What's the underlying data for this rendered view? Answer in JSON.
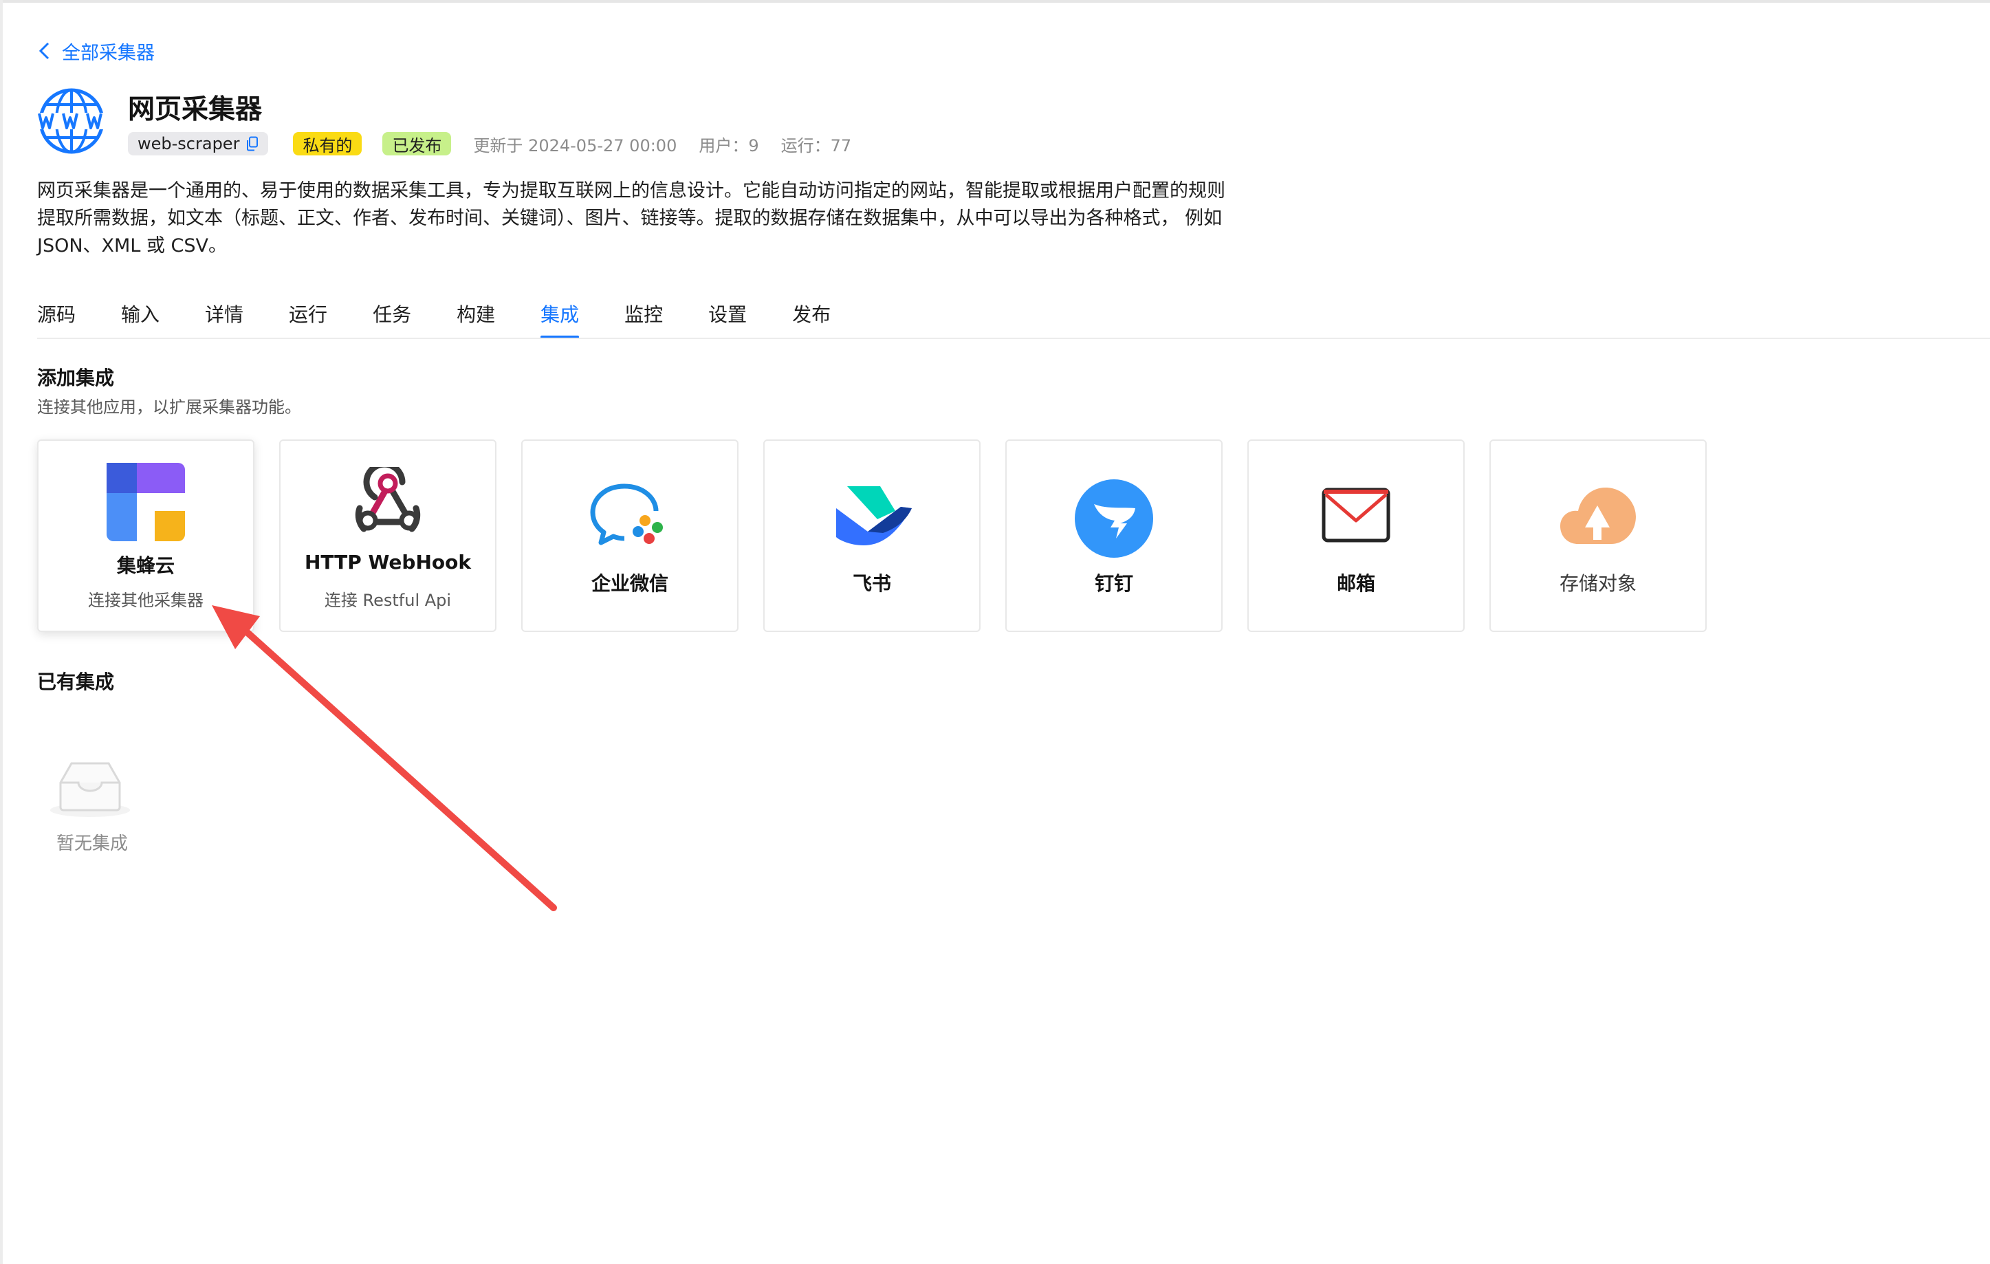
{
  "back_link": {
    "label": "全部采集器"
  },
  "header": {
    "title": "网页采集器",
    "id_tag": "web-scraper",
    "private_tag": "私有的",
    "published_tag": "已发布",
    "updated": "更新于 2024-05-27 00:00",
    "users": "用户：9",
    "runs": "运行：77"
  },
  "description": [
    "网页采集器是一个通用的、易于使用的数据采集工具，专为提取互联网上的信息设计。它能自动访问指定的网站，智能提取或根据用户配置的规则",
    "提取所需数据，如文本（标题、正文、作者、发布时间、关键词）、图片、链接等。提取的数据存储在数据集中，从中可以导出为各种格式， 例如",
    "JSON、XML 或 CSV。"
  ],
  "tabs": [
    "源码",
    "输入",
    "详情",
    "运行",
    "任务",
    "构建",
    "集成",
    "监控",
    "设置",
    "发布"
  ],
  "active_tab": "集成",
  "add_section": {
    "title": "添加集成",
    "subtitle": "连接其他应用，以扩展采集器功能。"
  },
  "cards": [
    {
      "name": "集蜂云",
      "desc": "连接其他采集器",
      "icon": "jifengyun-logo-icon"
    },
    {
      "name": "HTTP WebHook",
      "desc": "连接 Restful Api",
      "icon": "webhook-icon"
    },
    {
      "name": "企业微信",
      "desc": "",
      "icon": "wecom-icon"
    },
    {
      "name": "飞书",
      "desc": "",
      "icon": "feishu-icon"
    },
    {
      "name": "钉钉",
      "desc": "",
      "icon": "dingtalk-icon"
    },
    {
      "name": "邮箱",
      "desc": "",
      "icon": "mail-icon"
    },
    {
      "name": "存储对象",
      "desc": "",
      "icon": "cloud-upload-icon"
    }
  ],
  "existing_section": {
    "title": "已有集成",
    "empty_text": "暂无集成"
  },
  "colors": {
    "accent": "#1677ff",
    "private_tag": "#fadb14",
    "published_tag": "#c7f08a",
    "annotation_arrow": "#f04a45"
  }
}
